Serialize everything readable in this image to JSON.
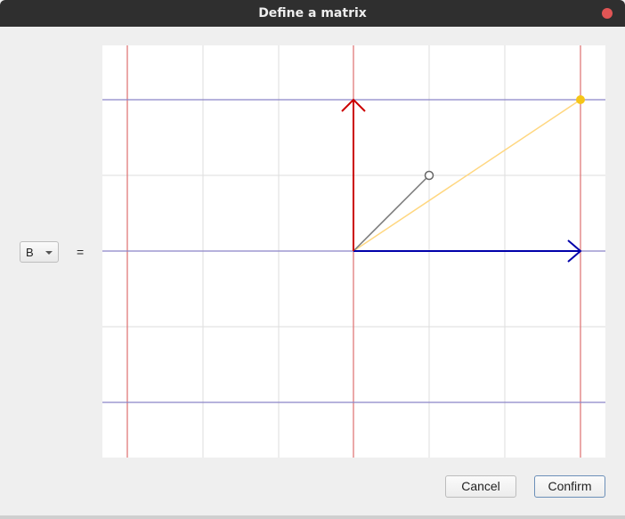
{
  "window": {
    "title": "Define a matrix"
  },
  "matrix_selector": {
    "selected": "B"
  },
  "equals_sign": "=",
  "buttons": {
    "cancel": "Cancel",
    "confirm": "Confirm"
  },
  "colors": {
    "title_bar": "#2f2f2f",
    "close_button": "#e05555",
    "grid_minor": "#dddddd",
    "basis_i": "#0000aa",
    "basis_j": "#cc0000",
    "transformed_vertical_lines": "#e07a7a",
    "transformed_horizontal_lines": "#8a84c8",
    "target_vector": "#ffd780",
    "target_point": "#f5c518",
    "drag_vector": "#777777"
  },
  "icons": {
    "close": "close-icon",
    "dropdown": "chevron-down-icon"
  }
}
